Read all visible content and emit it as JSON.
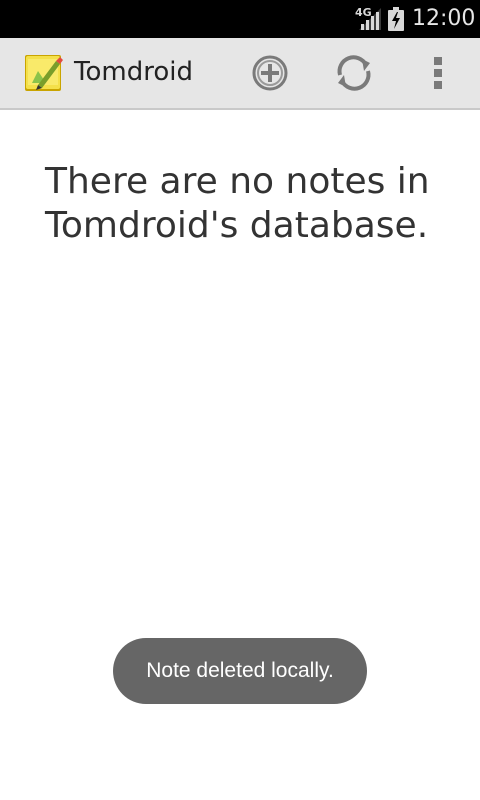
{
  "status_bar": {
    "network": "4G",
    "time": "12:00",
    "icons": [
      "signal-icon",
      "battery-charging-icon"
    ]
  },
  "action_bar": {
    "title": "Tomdroid",
    "icons": [
      "app-logo-icon",
      "add-note-icon",
      "sync-icon",
      "overflow-menu-icon"
    ]
  },
  "main": {
    "empty_message": "There are no notes in Tomdroid's database."
  },
  "toast": {
    "message": "Note deleted locally."
  },
  "colors": {
    "status_bar_bg": "#000000",
    "action_bar_bg": "#e6e6e6",
    "toast_bg": "#666666",
    "text": "#333333"
  }
}
